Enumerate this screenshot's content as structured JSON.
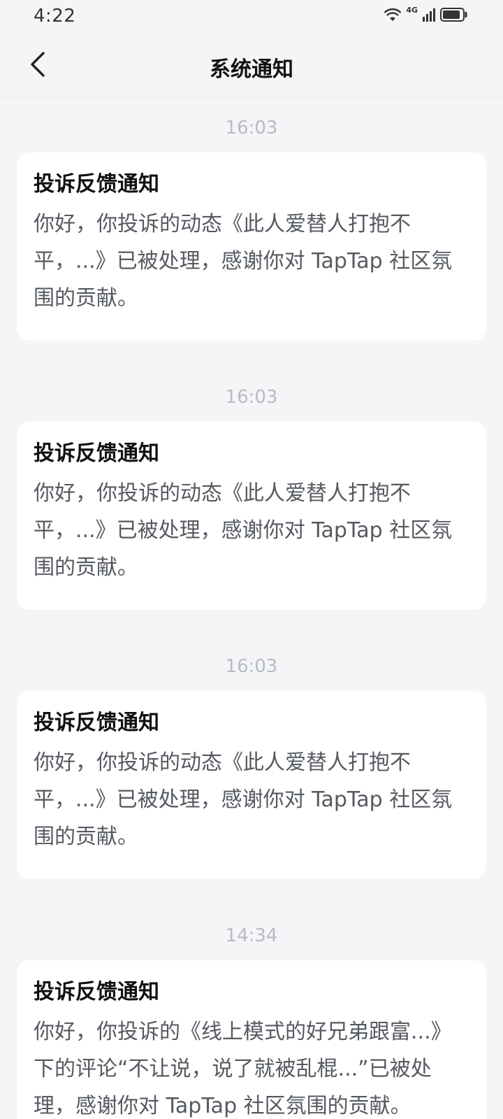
{
  "status": {
    "time": "4:22",
    "network_label": "4G"
  },
  "header": {
    "title": "系统通知"
  },
  "notifications": [
    {
      "time": "16:03",
      "title": "投诉反馈通知",
      "body": "你好，你投诉的动态《此人爱替人打抱不平，...》已被处理，感谢你对 TapTap 社区氛围的贡献。"
    },
    {
      "time": "16:03",
      "title": "投诉反馈通知",
      "body": "你好，你投诉的动态《此人爱替人打抱不平，...》已被处理，感谢你对 TapTap 社区氛围的贡献。"
    },
    {
      "time": "16:03",
      "title": "投诉反馈通知",
      "body": "你好，你投诉的动态《此人爱替人打抱不平，...》已被处理，感谢你对 TapTap 社区氛围的贡献。"
    },
    {
      "time": "14:34",
      "title": "投诉反馈通知",
      "body": "你好，你投诉的《线上模式的好兄弟跟富...》下的评论“不让说，说了就被乱棍...”已被处理，感谢你对 TapTap 社区氛围的贡献。"
    }
  ]
}
